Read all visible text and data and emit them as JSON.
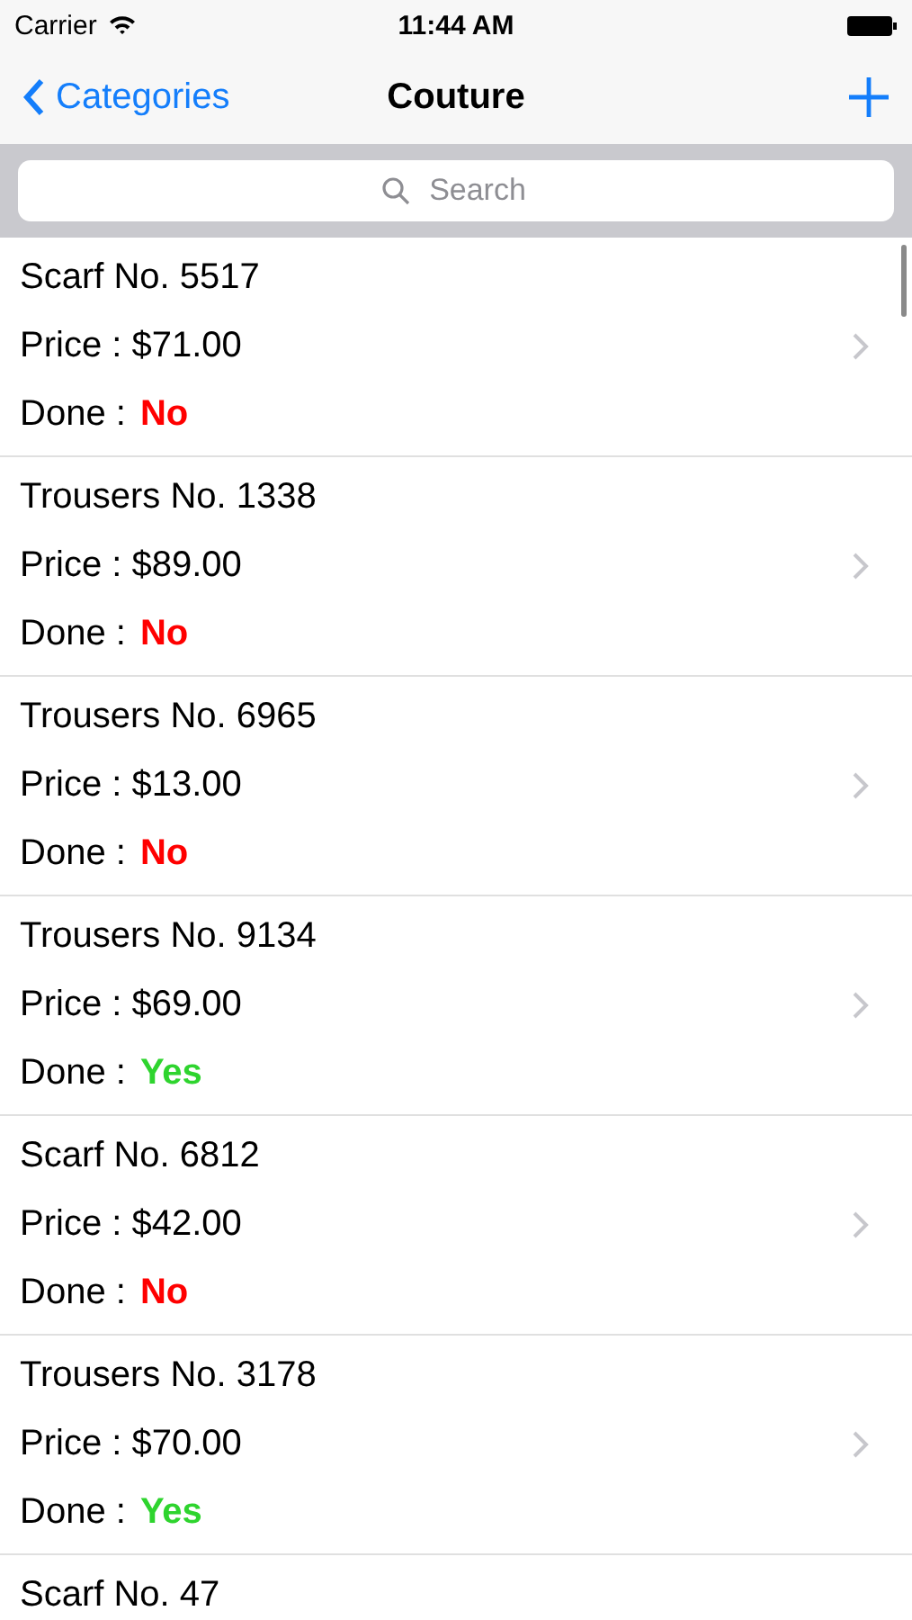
{
  "status_bar": {
    "carrier": "Carrier",
    "time": "11:44 AM"
  },
  "nav_bar": {
    "back_label": "Categories",
    "title": "Couture"
  },
  "search": {
    "placeholder": "Search"
  },
  "items": [
    {
      "title": "Scarf No. 5517",
      "price": "Price : $71.00",
      "done_label": "Done :",
      "done_value": "No",
      "done": false
    },
    {
      "title": "Trousers No. 1338",
      "price": "Price : $89.00",
      "done_label": "Done :",
      "done_value": "No",
      "done": false
    },
    {
      "title": "Trousers No. 6965",
      "price": "Price : $13.00",
      "done_label": "Done :",
      "done_value": "No",
      "done": false
    },
    {
      "title": "Trousers No. 9134",
      "price": "Price : $69.00",
      "done_label": "Done :",
      "done_value": "Yes",
      "done": true
    },
    {
      "title": "Scarf No. 6812",
      "price": "Price : $42.00",
      "done_label": "Done :",
      "done_value": "No",
      "done": false
    },
    {
      "title": "Trousers No. 3178",
      "price": "Price : $70.00",
      "done_label": "Done :",
      "done_value": "Yes",
      "done": true
    },
    {
      "title": "Scarf No. 47"
    }
  ]
}
